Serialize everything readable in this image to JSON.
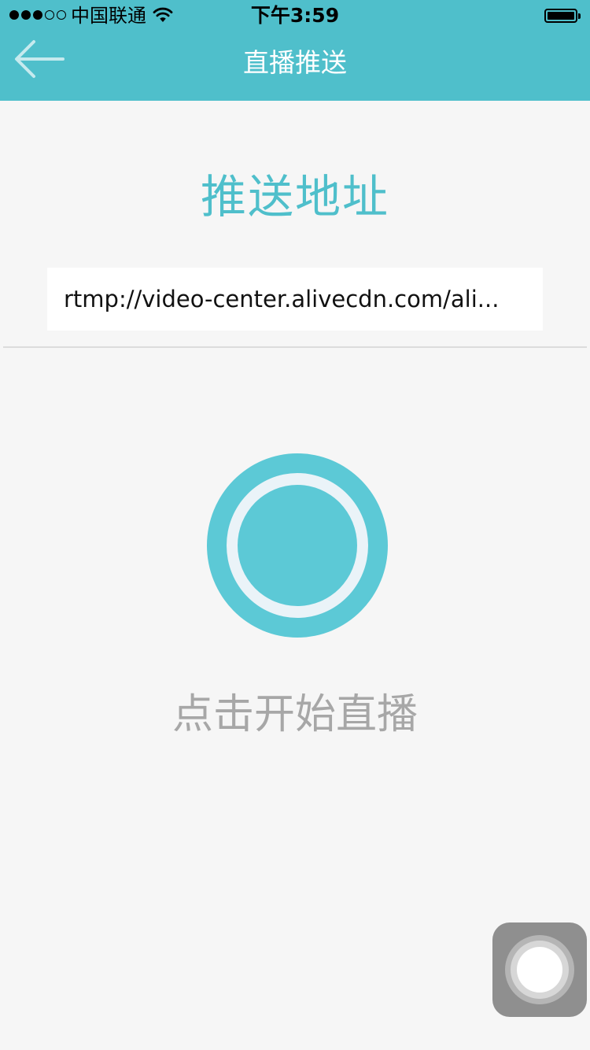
{
  "status_bar": {
    "carrier": "中国联通",
    "time": "下午3:59",
    "signal_bars_filled": 3,
    "signal_bars_total": 5,
    "battery_level": 1.0
  },
  "nav": {
    "title": "直播推送",
    "back_icon": "arrow-left-icon"
  },
  "push": {
    "heading": "推送地址",
    "url_value": "rtmp://video-center.alivecdn.com/ali..."
  },
  "start": {
    "label": "点击开始直播",
    "icon": "record-button-icon"
  },
  "assistive_touch": {
    "icon": "assistive-touch-icon"
  },
  "colors": {
    "accent": "#4fbfcb",
    "button": "#5cc9d6",
    "background": "#f6f6f6",
    "muted_text": "#a7a7a7"
  }
}
